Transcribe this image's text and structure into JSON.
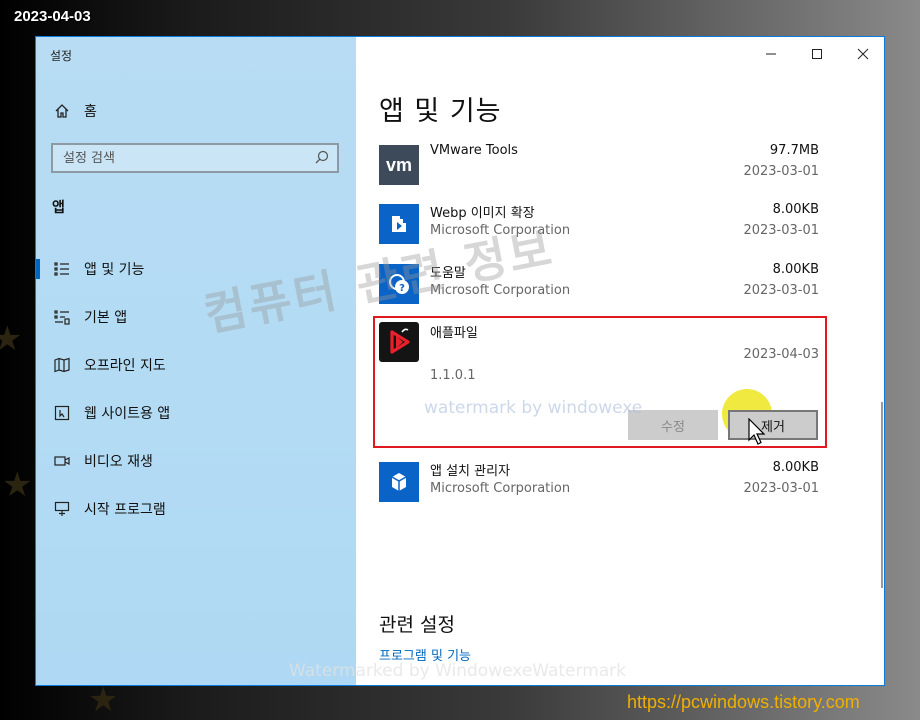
{
  "date_stamp": "2023-04-03",
  "window": {
    "title": "설정",
    "controls": {
      "minimize": "—",
      "maximize": "☐",
      "close": "✕"
    }
  },
  "sidebar": {
    "home_label": "홈",
    "search_placeholder": "설정 검색",
    "section": "앱",
    "items": [
      {
        "label": "앱 및 기능",
        "icon": "apps-features-icon",
        "active": true
      },
      {
        "label": "기본 앱",
        "icon": "default-apps-icon",
        "active": false
      },
      {
        "label": "오프라인 지도",
        "icon": "offline-maps-icon",
        "active": false
      },
      {
        "label": "웹 사이트용 앱",
        "icon": "apps-for-websites-icon",
        "active": false
      },
      {
        "label": "비디오 재생",
        "icon": "video-playback-icon",
        "active": false
      },
      {
        "label": "시작 프로그램",
        "icon": "startup-icon",
        "active": false
      }
    ]
  },
  "main": {
    "title": "앱 및 기능",
    "apps": [
      {
        "name": "VMware Tools",
        "publisher": "",
        "size": "97.7MB",
        "date": "2023-03-01",
        "icon": "vmware-icon"
      },
      {
        "name": "Webp 이미지 확장",
        "publisher": "Microsoft Corporation",
        "size": "8.00KB",
        "date": "2023-03-01",
        "icon": "webp-extension-icon"
      },
      {
        "name": "도움말",
        "publisher": "Microsoft Corporation",
        "size": "8.00KB",
        "date": "2023-03-01",
        "icon": "get-help-icon"
      },
      {
        "name": "애플파일",
        "version": "1.1.0.1",
        "size": "",
        "date": "2023-04-03",
        "icon": "applefile-icon",
        "selected": true
      },
      {
        "name": "앱 설치 관리자",
        "publisher": "Microsoft Corporation",
        "size": "8.00KB",
        "date": "2023-03-01",
        "icon": "app-installer-icon"
      }
    ],
    "buttons": {
      "modify": "수정",
      "uninstall": "제거"
    },
    "related": {
      "title": "관련 설정",
      "link": "프로그램 및 기능"
    }
  },
  "watermarks": {
    "big": "컴퓨터 관련 정보",
    "mid": "watermark by windowexe",
    "bottom": "Watermarked by WindowexeWatermark"
  },
  "site_url": "https://pcwindows.tistory.com",
  "colors": {
    "accent": "#0067c0",
    "highlight_border": "#e0191e",
    "sidebar_bg": "#b7dcf3",
    "url_text": "#f0b000",
    "cursor_halo": "#ebe100"
  }
}
